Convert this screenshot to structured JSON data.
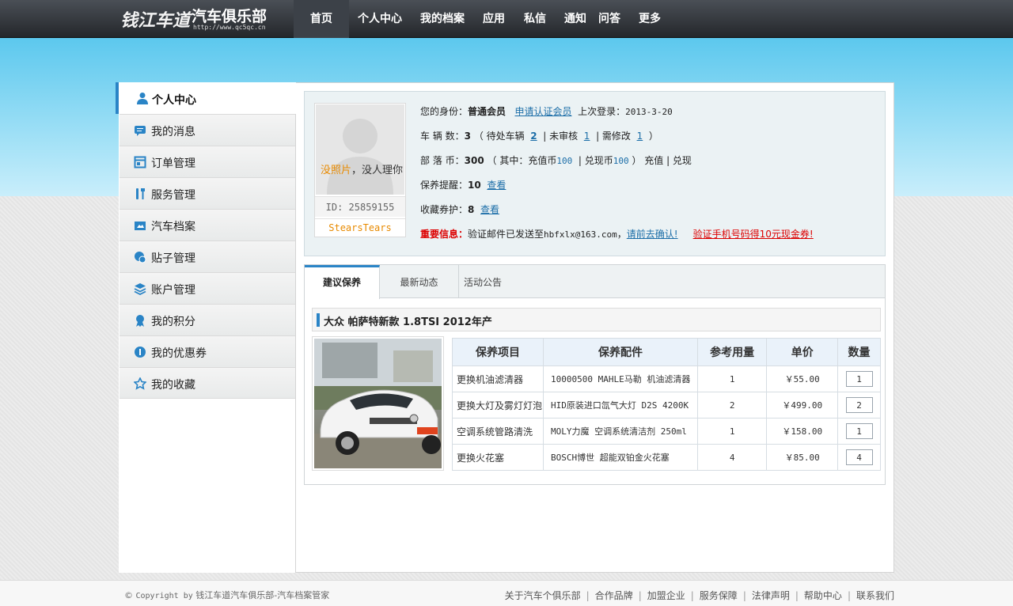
{
  "header": {
    "logo_script": "钱江车道",
    "logo_name": "汽车俱乐部",
    "logo_url": "http://www.qc5qc.cn",
    "nav": [
      "首页",
      "个人中心",
      "我的档案",
      "应用",
      "私信",
      "通知",
      "问答",
      "更多"
    ]
  },
  "sidebar": {
    "title": "个人中心",
    "items": [
      {
        "label": "我的消息",
        "icon": "message-icon"
      },
      {
        "label": "订单管理",
        "icon": "order-icon"
      },
      {
        "label": "服务管理",
        "icon": "tools-icon"
      },
      {
        "label": "汽车档案",
        "icon": "car-file-icon"
      },
      {
        "label": "贴子管理",
        "icon": "chat-icon"
      },
      {
        "label": "账户管理",
        "icon": "layers-icon"
      },
      {
        "label": "我的积分",
        "icon": "badge-icon"
      },
      {
        "label": "我的优惠券",
        "icon": "coupon-icon"
      },
      {
        "label": "我的收藏",
        "icon": "star-icon"
      }
    ]
  },
  "profile": {
    "avatar_no_photo": "没照片",
    "avatar_text": "，没人理你",
    "id_text": "ID: 25859155",
    "username": "StearsTears",
    "identity_label": "您的身份：",
    "identity_value": "普通会员",
    "apply_link": "申请认证会员",
    "last_login_label": "上次登录：",
    "last_login_value": "2013-3-20",
    "vehicles_label": "车 辆 数：",
    "vehicles_count": "3",
    "vehicles_detail_1": "（ 待处车辆",
    "vehicles_pending": "2",
    "vehicles_detail_2": "| 未审核",
    "vehicles_unreviewed": "1",
    "vehicles_detail_3": "| 需修改",
    "vehicles_modify": "1",
    "vehicles_detail_4": "）",
    "coins_label": "部 落 币：",
    "coins_value": "300",
    "coins_detail_1": "（ 其中：充值币",
    "coins_recharge": "100",
    "coins_detail_2": "| 兑现币",
    "coins_cash": "100",
    "coins_detail_3": "） 充值 | 兑现",
    "reminder_label": "保养提醒：",
    "reminder_value": "10",
    "reminder_link": "查看",
    "favorites_label": "收藏券护：",
    "favorites_value": "8",
    "favorites_link": "查看",
    "important_label": "重要信息：",
    "important_text": "验证邮件已发送至",
    "important_email": "hbfxlx@163.com",
    "important_sep": "，",
    "important_confirm": "请前去确认!",
    "important_phone": "验证手机号码得10元现金券!"
  },
  "tabs": [
    "建议保养",
    "最新动态",
    "活动公告"
  ],
  "car": {
    "title": "大众 帕萨特新款 1.8TSI 2012年产"
  },
  "maintenance": {
    "headers": [
      "保养项目",
      "保养配件",
      "参考用量",
      "单价",
      "数量"
    ],
    "rows": [
      {
        "item": "更换机油滤清器",
        "part": "10000500 MAHLE马勒 机油滤清器",
        "usage": "1",
        "price": "￥55.00",
        "qty": "1"
      },
      {
        "item": "更换大灯及雾灯灯泡",
        "part": "HID原装进口氙气大灯 D2S 4200K",
        "usage": "2",
        "price": "￥499.00",
        "qty": "2"
      },
      {
        "item": "空调系统管路清洗",
        "part": "MOLY力魔 空调系统清洁剂 250ml",
        "usage": "1",
        "price": "￥158.00",
        "qty": "1"
      },
      {
        "item": "更换火花塞",
        "part": "BOSCH博世 超能双铂金火花塞",
        "usage": "4",
        "price": "￥85.00",
        "qty": "4"
      }
    ]
  },
  "footer": {
    "copyright_symbol": "©",
    "copyright_en": "Copyright by",
    "copyright_cn": "钱江车道汽车俱乐部-汽车档案管家",
    "links": [
      "关于汽车个俱乐部",
      "合作品牌",
      "加盟企业",
      "服务保障",
      "法律声明",
      "帮助中心",
      "联系我们"
    ]
  },
  "colors": {
    "accent": "#2a84c6",
    "price": "#cc0000",
    "warning": "#dd0000",
    "highlight": "#e88a00"
  }
}
